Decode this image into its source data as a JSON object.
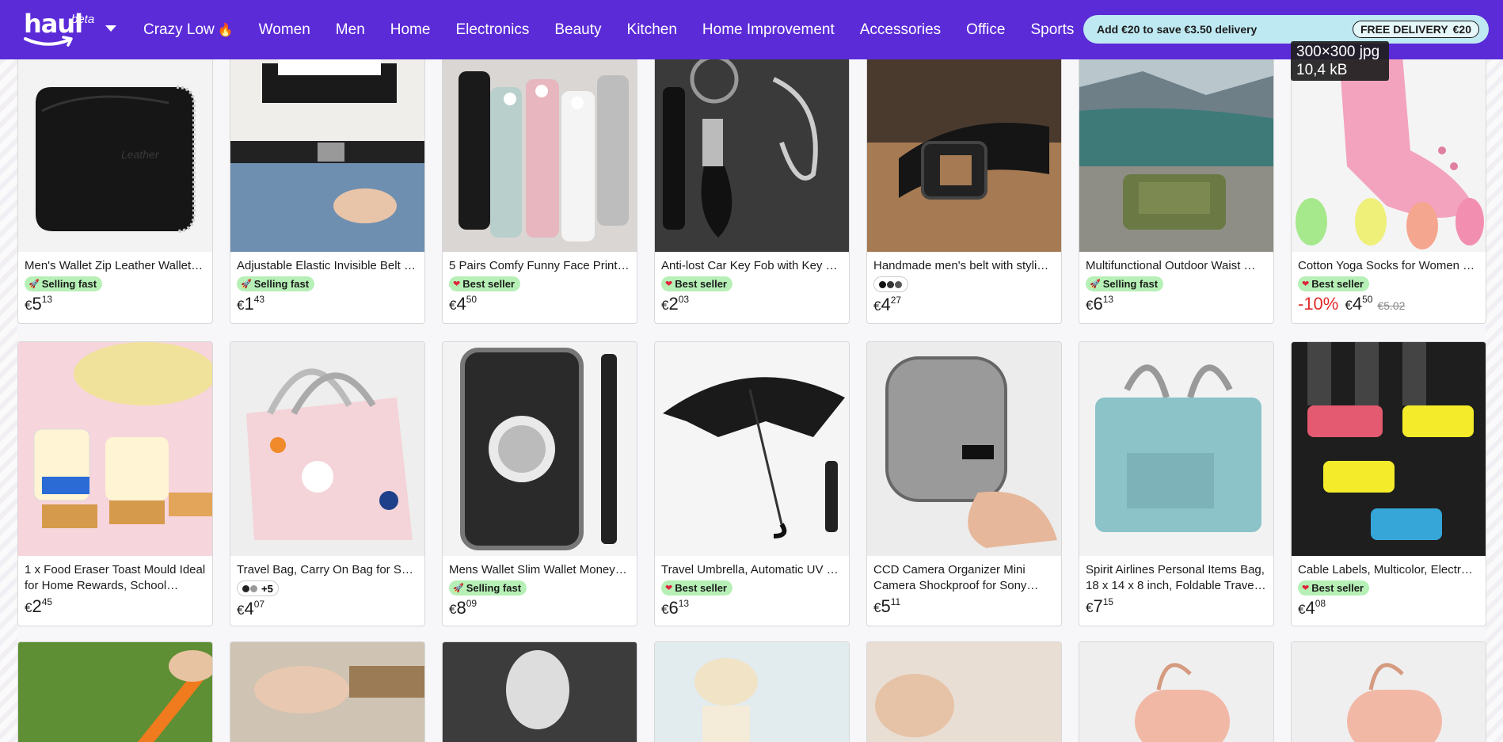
{
  "header": {
    "logo_word": "haul",
    "logo_beta": "beta",
    "nav": [
      {
        "label": "Crazy Low",
        "icon": "flame-icon"
      },
      {
        "label": "Women"
      },
      {
        "label": "Men"
      },
      {
        "label": "Home"
      },
      {
        "label": "Electronics"
      },
      {
        "label": "Beauty"
      },
      {
        "label": "Kitchen"
      },
      {
        "label": "Home Improvement"
      },
      {
        "label": "Accessories"
      },
      {
        "label": "Office"
      },
      {
        "label": "Sports"
      }
    ],
    "delivery": {
      "text": "Add €20 to save €3.50 delivery",
      "pill_label": "FREE DELIVERY",
      "pill_amount": "€20"
    },
    "tooltip": {
      "line1": "300×300 jpg",
      "line2": "10,4 kB"
    }
  },
  "products": [
    {
      "title": "Men's Wallet Zip Leather Wallet…",
      "badge": "Selling fast",
      "badge_icon": "rocket-icon",
      "currency": "€",
      "price_int": "5",
      "price_dec": "13",
      "img": "wallet-black"
    },
    {
      "title": "Adjustable Elastic Invisible Belt …",
      "badge": "Selling fast",
      "badge_icon": "rocket-icon",
      "currency": "€",
      "price_int": "1",
      "price_dec": "43",
      "img": "belt-jeans"
    },
    {
      "title": "5 Pairs Comfy Funny Face Print …",
      "badge": "Best seller",
      "badge_icon": "heart-icon",
      "currency": "€",
      "price_int": "4",
      "price_dec": "50",
      "img": "socks"
    },
    {
      "title": "Anti-lost Car Key Fob with Key …",
      "badge": "Best seller",
      "badge_icon": "heart-icon",
      "currency": "€",
      "price_int": "2",
      "price_dec": "03",
      "img": "keyfob"
    },
    {
      "title": "Handmade men's belt with styli…",
      "badge": "",
      "swatch": "",
      "currency": "€",
      "price_int": "4",
      "price_dec": "27",
      "img": "belt-leather"
    },
    {
      "title": "Multifunctional Outdoor Waist …",
      "badge": "Selling fast",
      "badge_icon": "rocket-icon",
      "currency": "€",
      "price_int": "6",
      "price_dec": "13",
      "img": "waist-bag"
    },
    {
      "title": "Cotton Yoga Socks for Women …",
      "badge": "Best seller",
      "badge_icon": "heart-icon",
      "discount": "-10%",
      "currency": "€",
      "price_int": "4",
      "price_dec": "50",
      "old_price": "€5.02",
      "img": "yoga-socks"
    },
    {
      "title": "1 x Food Eraser Toast Mould Ideal for Home Rewards, School…",
      "badge": "",
      "currency": "€",
      "price_int": "2",
      "price_dec": "45",
      "img": "eraser"
    },
    {
      "title": "Travel Bag, Carry On Bag for Sp…",
      "badge": "",
      "swatch": "+5",
      "currency": "€",
      "price_int": "4",
      "price_dec": "07",
      "img": "travel-bag-pink"
    },
    {
      "title": "Mens Wallet Slim Wallet Money…",
      "badge": "Selling fast",
      "badge_icon": "rocket-icon",
      "currency": "€",
      "price_int": "8",
      "price_dec": "09",
      "img": "slim-wallet"
    },
    {
      "title": "Travel Umbrella, Automatic UV …",
      "badge": "Best seller",
      "badge_icon": "heart-icon",
      "currency": "€",
      "price_int": "6",
      "price_dec": "13",
      "img": "umbrella"
    },
    {
      "title": "CCD Camera Organizer Mini Camera Shockproof for Sony…",
      "badge": "",
      "currency": "€",
      "price_int": "5",
      "price_dec": "11",
      "img": "camera-case"
    },
    {
      "title": "Spirit Airlines Personal Items Bag, 18 x 14 x 8 inch, Foldable Trave…",
      "badge": "",
      "currency": "€",
      "price_int": "7",
      "price_dec": "15",
      "img": "duffel-blue"
    },
    {
      "title": "Cable Labels, Multicolor, Electr…",
      "badge": "Best seller",
      "badge_icon": "heart-icon",
      "currency": "€",
      "price_int": "4",
      "price_dec": "08",
      "img": "cable-labels"
    }
  ],
  "bottom_row": [
    "garden-tool",
    "sewing",
    "lingerie",
    "candle",
    "bracelet",
    "pink-case",
    "pink-case"
  ]
}
